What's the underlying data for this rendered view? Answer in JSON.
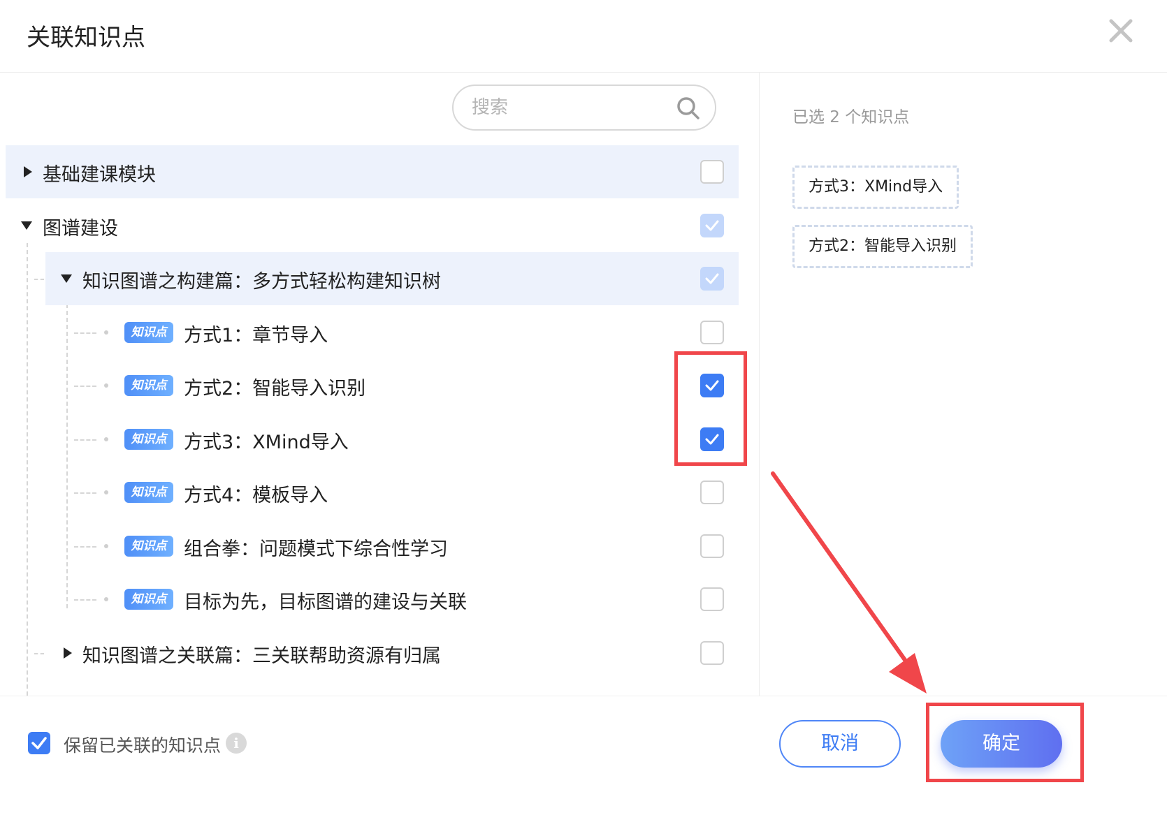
{
  "dialog": {
    "title": "关联知识点"
  },
  "search": {
    "placeholder": "搜索"
  },
  "tree": [
    {
      "label": "基础建课模块",
      "checked": false
    },
    {
      "label": "图谱建设",
      "checked": "partial"
    },
    {
      "label": "知识图谱之构建篇：多方式轻松构建知识树",
      "checked": "partial"
    },
    {
      "tag": "知识点",
      "label": "方式1：章节导入",
      "checked": false
    },
    {
      "tag": "知识点",
      "label": "方式2：智能导入识别",
      "checked": true
    },
    {
      "tag": "知识点",
      "label": "方式3：XMind导入",
      "checked": true
    },
    {
      "tag": "知识点",
      "label": "方式4：模板导入",
      "checked": false
    },
    {
      "tag": "知识点",
      "label": "组合拳：问题模式下综合性学习",
      "checked": false
    },
    {
      "tag": "知识点",
      "label": "目标为先，目标图谱的建设与关联",
      "checked": false
    },
    {
      "label": "知识图谱之关联篇：三关联帮助资源有归属",
      "checked": false
    }
  ],
  "selected": {
    "count_text": "已选 2 个知识点",
    "items": [
      "方式3：XMind导入",
      "方式2：智能导入识别"
    ]
  },
  "footer": {
    "keep_label": "保留已关联的知识点",
    "keep_checked": true,
    "info_glyph": "i",
    "cancel_label": "取消",
    "ok_label": "确定"
  },
  "colors": {
    "primary": "#3d7cf4",
    "annotation_red": "#f0464a"
  },
  "icons": [
    "close-icon",
    "search-icon",
    "caret-right-icon",
    "caret-down-icon",
    "check-icon",
    "info-icon"
  ]
}
